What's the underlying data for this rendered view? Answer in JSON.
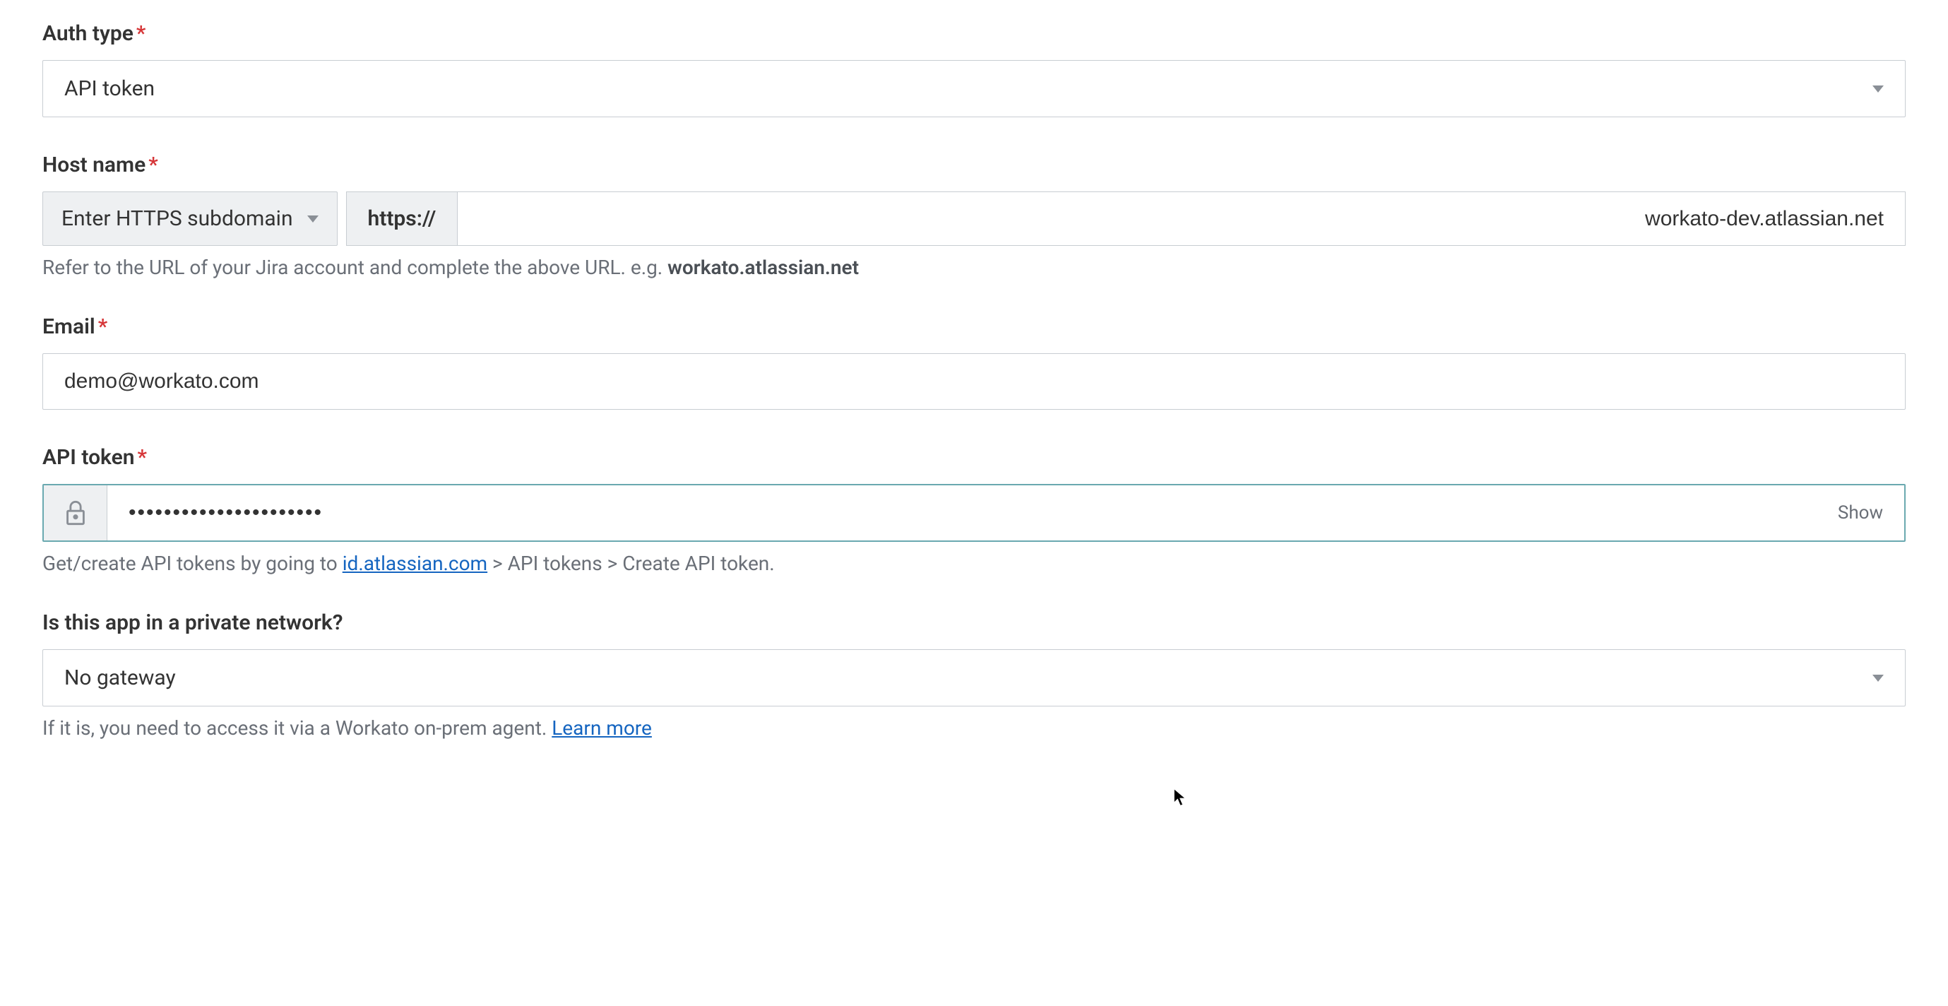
{
  "authType": {
    "label": "Auth type",
    "value": "API token"
  },
  "hostName": {
    "label": "Host name",
    "selectorLabel": "Enter HTTPS subdomain",
    "prefix": "https://",
    "value": "workato-dev.atlassian.net",
    "helperPrefix": "Refer to the URL of your Jira account and complete the above URL. e.g. ",
    "helperExample": "workato.atlassian.net"
  },
  "email": {
    "label": "Email",
    "value": "demo@workato.com"
  },
  "apiToken": {
    "label": "API token",
    "maskedValue": "••••••••••••••••••••••",
    "showLabel": "Show",
    "helperPrefix": "Get/create API tokens by going to ",
    "helperLink": "id.atlassian.com",
    "helperSuffix": " > API tokens > Create API token."
  },
  "privateNetwork": {
    "label": "Is this app in a private network?",
    "value": "No gateway",
    "helperPrefix": "If it is, you need to access it via a Workato on-prem agent. ",
    "helperLink": "Learn more"
  }
}
